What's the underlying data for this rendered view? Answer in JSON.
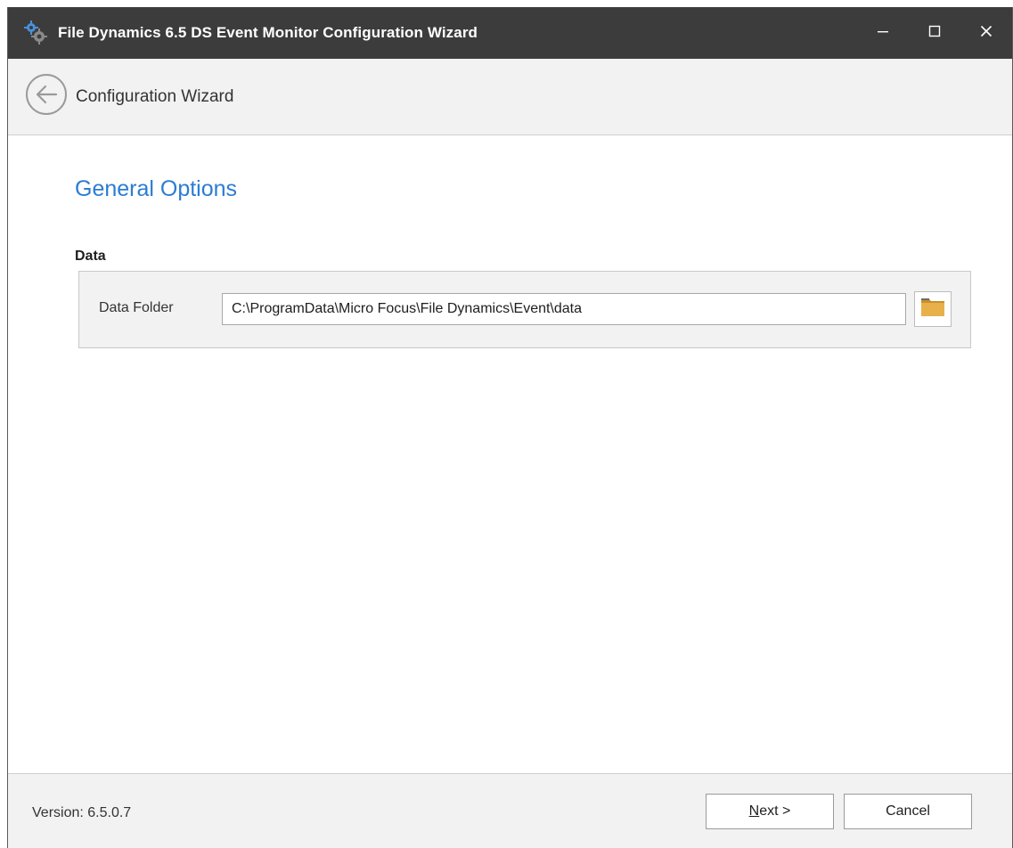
{
  "window": {
    "title": "File Dynamics 6.5 DS Event Monitor Configuration Wizard",
    "app_icon": "gears-icon",
    "controls": [
      "minimize-icon",
      "maximize-icon",
      "close-icon"
    ]
  },
  "header": {
    "back_icon": "back-arrow-circle-icon",
    "title": "Configuration Wizard"
  },
  "main": {
    "page_title": "General Options",
    "section_label": "Data",
    "data_folder": {
      "label": "Data Folder",
      "value": "C:\\ProgramData\\Micro Focus\\File Dynamics\\Event\\data",
      "browse_icon": "folder-icon"
    }
  },
  "footer": {
    "version": "Version: 6.5.0.7",
    "next_mnemonic": "N",
    "next_rest": "ext >",
    "cancel_label": "Cancel"
  },
  "colors": {
    "titlebar": "#3c3c3c",
    "accent": "#2b7cd3",
    "panel": "#f2f2f2",
    "folder": "#e8b04a"
  }
}
